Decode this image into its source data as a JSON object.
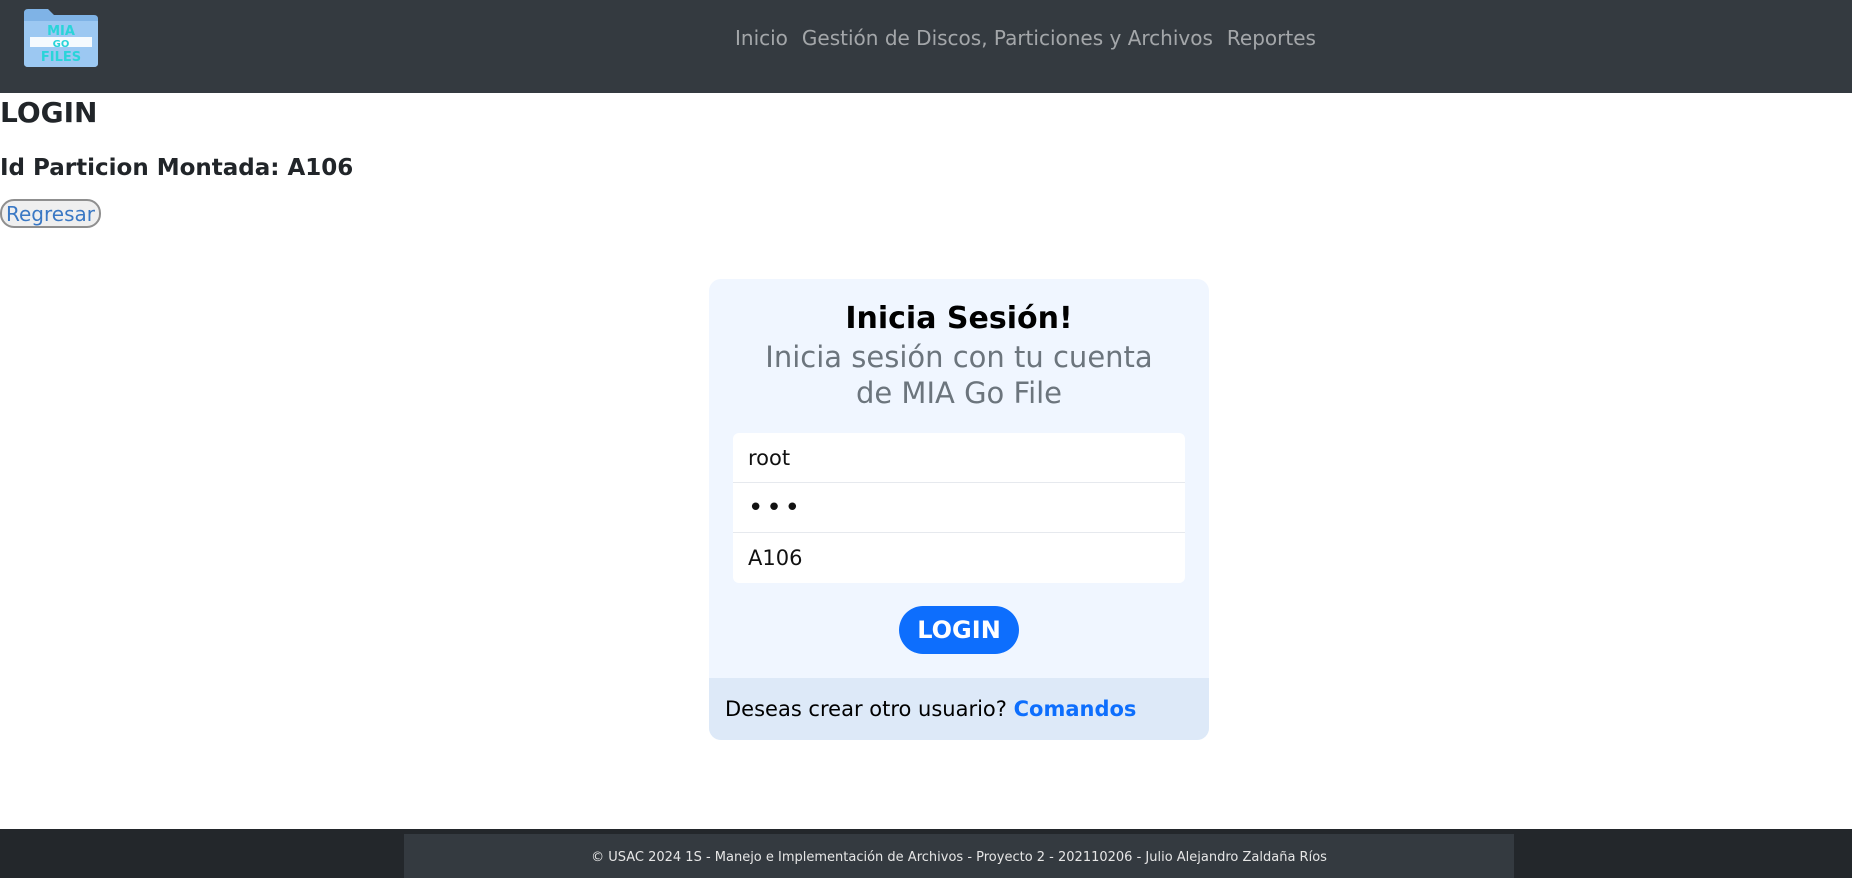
{
  "header": {
    "logo_text": "MIA GO FILES",
    "nav": [
      "Inicio",
      "Gestión de Discos, Particiones y Archivos",
      "Reportes"
    ]
  },
  "page": {
    "title": "LOGIN",
    "partition_label": "Id Particion Montada: A106",
    "back_label": "Regresar"
  },
  "login_card": {
    "title": "Inicia Sesión!",
    "subtitle": "Inicia sesión con tu cuenta de MIA Go File",
    "username_value": "root",
    "password_value": "•••",
    "partition_value": "A106",
    "login_label": "LOGIN",
    "footer_text": "Deseas crear otro usuario?",
    "footer_link": "Comandos"
  },
  "footer": {
    "text": "© USAC 2024 1S - Manejo e Implementación de Archivos - Proyecto 2 - 202110206 - Julio Alejandro Zaldaña Ríos"
  },
  "colors": {
    "navbar": "#343a40",
    "primary": "#0d6efd",
    "card_bg": "#f0f6ff",
    "card_footer_bg": "#dde9f8"
  }
}
